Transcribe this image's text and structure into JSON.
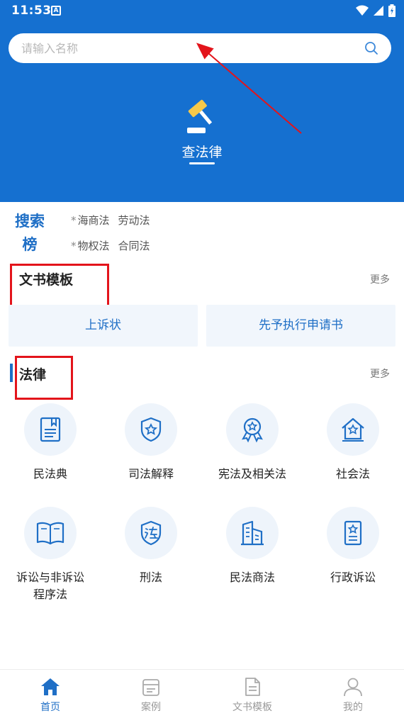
{
  "status_bar": {
    "time": "11:53",
    "notification_badge": "A"
  },
  "search": {
    "placeholder": "请输入名称"
  },
  "hero": {
    "label": "查法律"
  },
  "ranking": {
    "title": "搜索榜",
    "rows": [
      {
        "prefix": "*",
        "items": [
          "海商法",
          "劳动法"
        ]
      },
      {
        "prefix": "*",
        "items": [
          "物权法",
          "合同法"
        ]
      }
    ]
  },
  "templates": {
    "title": "文书模板",
    "more": "更多",
    "buttons": [
      "上诉状",
      "先予执行申请书"
    ]
  },
  "laws": {
    "title": "法律",
    "more": "更多",
    "items": [
      {
        "label": "民法典",
        "icon": "civil-code-icon"
      },
      {
        "label": "司法解释",
        "icon": "judicial-interpretation-icon"
      },
      {
        "label": "宪法及相关法",
        "icon": "constitution-icon"
      },
      {
        "label": "社会法",
        "icon": "social-law-icon"
      },
      {
        "label": "诉讼与非诉讼程序法",
        "icon": "procedure-law-icon"
      },
      {
        "label": "刑法",
        "icon": "criminal-law-icon"
      },
      {
        "label": "民法商法",
        "icon": "commercial-law-icon"
      },
      {
        "label": "行政诉讼",
        "icon": "administrative-litigation-icon"
      }
    ]
  },
  "bottom_nav": [
    {
      "label": "首页",
      "icon": "home-icon",
      "active": true
    },
    {
      "label": "案例",
      "icon": "cases-icon",
      "active": false
    },
    {
      "label": "文书模板",
      "icon": "document-template-icon",
      "active": false
    },
    {
      "label": "我的",
      "icon": "profile-icon",
      "active": false
    }
  ],
  "colors": {
    "primary": "#1570d0",
    "accent": "#1f6fc6",
    "annotation": "#e3141b"
  }
}
